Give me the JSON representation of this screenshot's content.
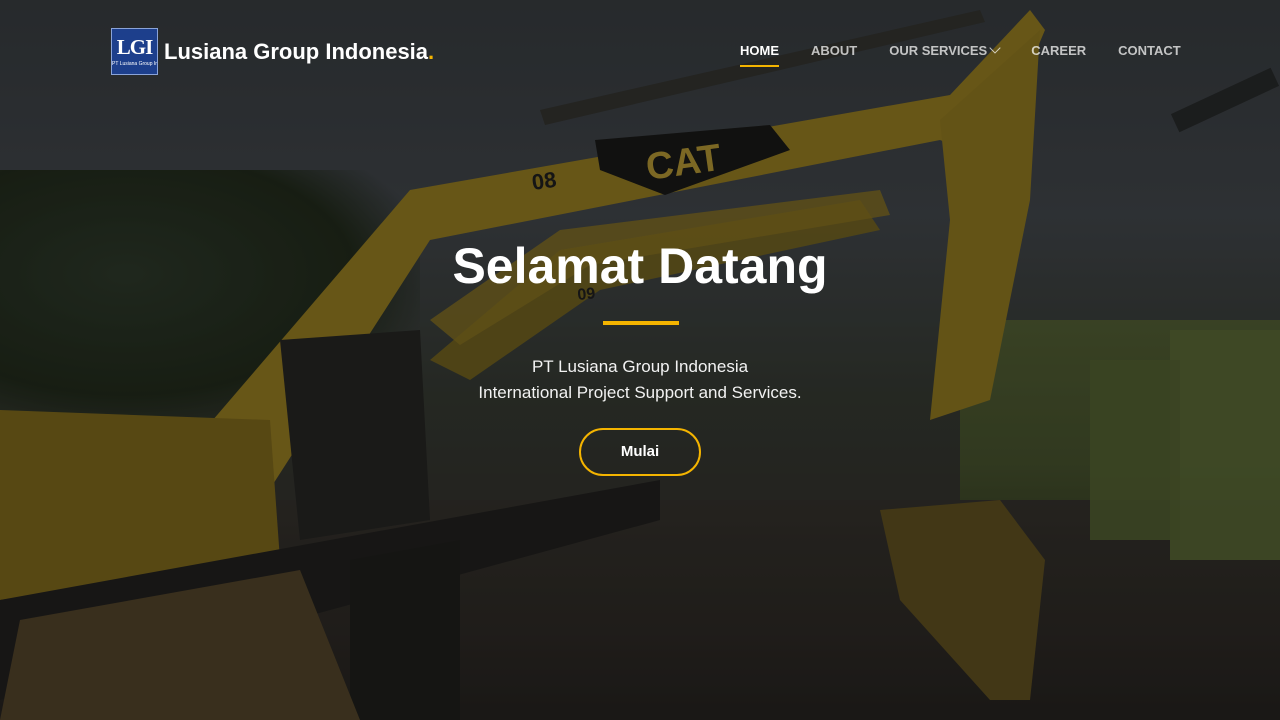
{
  "header": {
    "logo": {
      "mark": "LGI",
      "subtext": "PT Lusiana Group Indonesia"
    },
    "brand_name": "Lusiana Group Indonesia",
    "brand_dot": ".",
    "nav": [
      {
        "label": "HOME",
        "active": true
      },
      {
        "label": "ABOUT",
        "active": false
      },
      {
        "label": "OUR SERVICES",
        "active": false,
        "dropdown": true
      },
      {
        "label": "CAREER",
        "active": false
      },
      {
        "label": "CONTACT",
        "active": false
      }
    ]
  },
  "hero": {
    "title": "Selamat Datang",
    "subtitle_line1": "PT Lusiana Group Indonesia",
    "subtitle_line2": "International Project Support and Services.",
    "cta_label": "Mulai",
    "background_image": {
      "bucket_text": "08",
      "brand_text": "CAT",
      "bucket_text_2": "09"
    }
  },
  "colors": {
    "accent": "#f4b400",
    "logo_background": "#1d3f8c",
    "text": "#ffffff"
  },
  "icons": {
    "services_dropdown": "chevron-down-icon"
  }
}
